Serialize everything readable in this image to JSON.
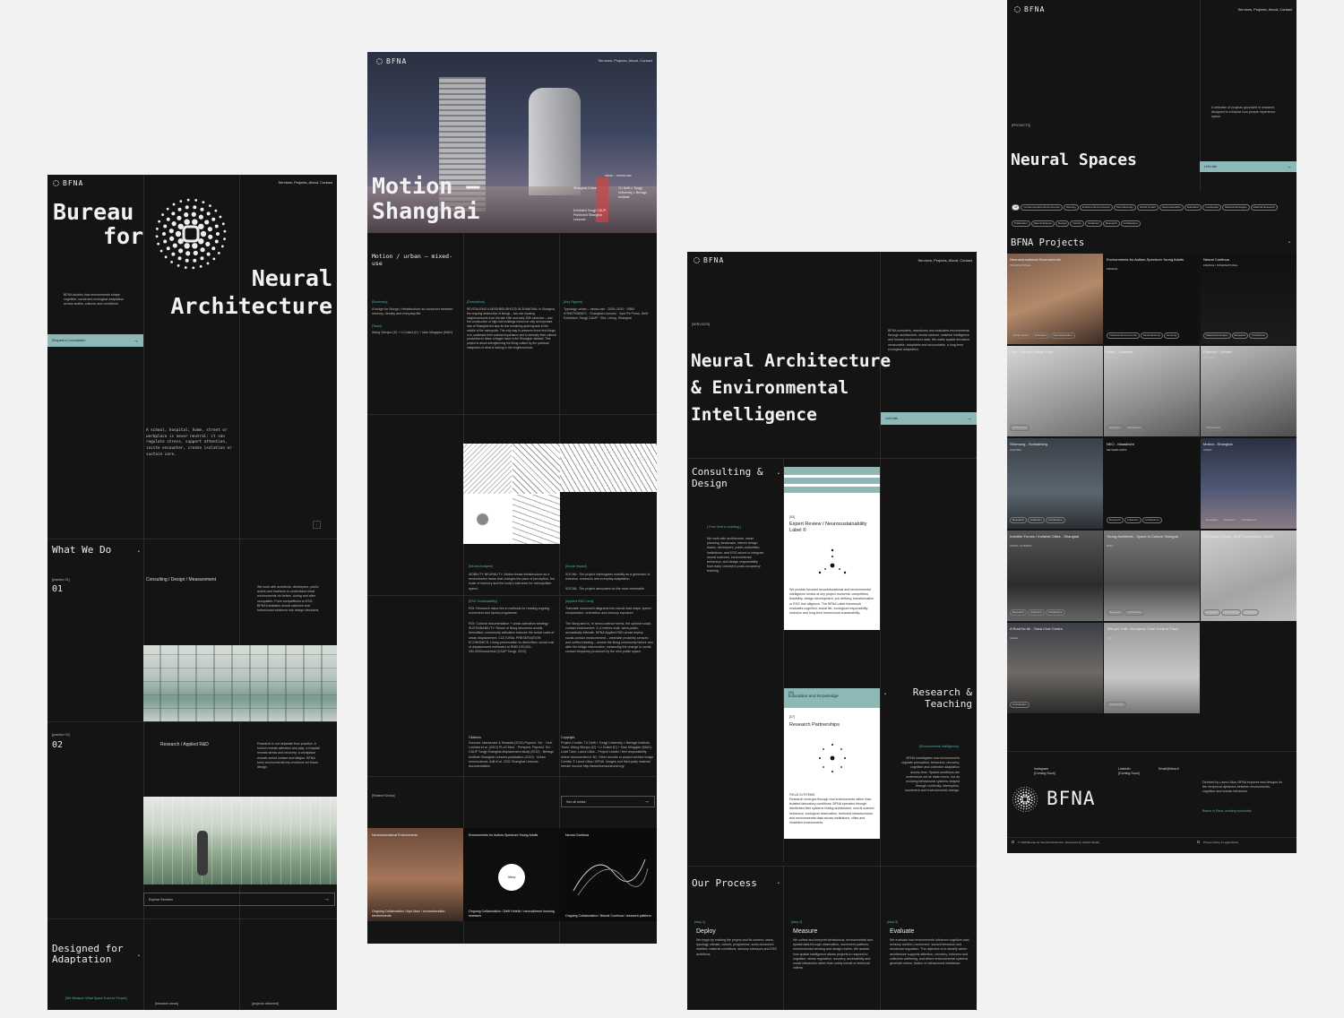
{
  "site": {
    "logo": "BFNA",
    "nav": "Services, Projects, About, Contact"
  },
  "home": {
    "title_lines": [
      "Bureau",
      "for",
      "Neural",
      "Architecture"
    ],
    "intro": "BFNA studies how environments shape cognitive, social and ecological adaptation across scales, cultures and conditions.",
    "cta": "Request a Consultation",
    "statement": "A school, hospital, home, street or workplace is never neutral: it can regulate stress, support attention, invite encounter, create isolation or sustain care.",
    "what_we_do": "What We Do",
    "p1_label": "[practice 01]",
    "p1_num": "01",
    "p1_title": "Consulting / Design / Measurement",
    "p1_text": "We work with architects, developers, public actors and investors to understand what environments do before, during and after occupation. From competitions to ESG, BFNA translates neural sciences and behavioural evidence into design decisions.",
    "p2_label": "[practice 02]",
    "p2_num": "02",
    "p2_title": "Research / Applied R&D",
    "p2_text": "Research is not separate from practice. A school reveals attention and play; a hospital reveals stress and recovery; a workplace reveals social contact and fatigue. BFNA turns environments into evidence for future design.",
    "explore": "Explore Services",
    "adapt_lines": [
      "Designed for",
      "Adaptation"
    ],
    "measure": "[We Measure What Space Does to People]",
    "r1": "[research areas]",
    "r2": "[projects delivered]"
  },
  "project": {
    "title_lines": [
      "Motion –",
      "Shanghai"
    ],
    "hero_meta": [
      "urban – mixed-use",
      "Shanghai China",
      "TU Delft × Tongji University × Berlage Institute",
      "Exhibited Tongji CAUP, Published Shanghai Lessons"
    ],
    "subtitle": "Motion / urban – mixed-use",
    "summary_h": "[Summary]",
    "summary": "A bridge for Mongo / infrastructure as connector between memory, density and everyday life.",
    "team_h": "[Team]",
    "team": "Wang Wenjun (D) + Li Duikui (K) + Mao Mingqian (M&D)",
    "desc_h": "[Description]",
    "desc": "REVITALISING A NEIGHBOURHOOD IN SHANGHAI: In Shanghai, the ongoing destruction of lilongs – low-rise housing neighbourhoods from the late 19th and early 20th centuries – and the construction of high-rise buildings mean not only an important loss of Shanghai but also its few remaining quiet layouts in the middle of the metropolis. The only way to preserve these few lilongs is to undertake their cultural importance and to intensify their cultural production to leave a trigger trace in the Shanghai mindset. This project is about strengthening the lilong culture by the punctual integration of what is lacking in the neighbourhood.",
    "fig_h": "[Key Figures]",
    "fig": "Typology: urban – mixed-use · 2009–2010 · ISBN 9789079369871 · Shanghai Lessons · Xym Pa Press, Delft · Exhibition: Tongji CAUP · Site: Lilong, Shanghai",
    "neural_h": "[Neural Analysis]",
    "neural": "MOBILITY NEURALITY: Motion treats infrastructure as a sensorimotor frame that changes the pace of perception, the scale of memory and the body's tolerance for metropolitan speed.",
    "social_h": "[Social Impact]",
    "social": "SOCIAL: The project interrogates mobility as a generator of inclusion, exclusion and everyday adaptation.",
    "social2": "SOCIAL: The project advocates for the most vulnerable",
    "esg_h": "[ESG Sustainability]",
    "esg": "ROI: Research value lies in methods for reading ongoing movement and hybrid programme.",
    "esg2": "ROI: Cultural documentation + urban activation strategy. SUSTAINABILITY: Reuse of lilong structures avoids demolition; community activation reduces the social costs of urban displacement. CULTURAL PRESERVATION ECONOMICS: Lilong preservation vs demolition: social cost of displacement estimated at RMB 100,000–250,000/household (CAUP Tongji, 2012).",
    "rd_h": "[Applied R&D Lens]",
    "rd": "Translate movement diagrams into neural load maps: speed, compression, orientation and sensory exposure.",
    "rd2": "The lilong lane is, in neuro-science terms, the optimal social-contact environment: 3–5 metres wide, semi-public, acoustically intimate. BFNA Applied R&D would deploy social-contact measurement – wearable proximity sensors and unified tracking – across the lilong community before and after the bridge intervention, measuring the change in social-contact frequency produced by the new public space.",
    "cit_h": "Citations",
    "cit": "Sources: Mackenzie & Mossala (2010) Psychol. Sci. · Holt-Lunstad et al. (2010) PLoS Med. · Perspect. Psychol. Sci. · CAUP Tongji Shanghai displacement study (2012) · Berlage Institute Shanghai Lessons publication (2010) · Urban neuroscience: Adli et al. 2022 Shanghai Lessons documentation.",
    "copy_h": "Copyright",
    "copy": "Project Credits: TU Delft × Tongji University × Berlage Institute. Team: Wang Wenjun (D) + Li Duikui (K) + Mao Mingqian (M&D). Lead Tutor: Laura Ulloa – Project Leader / text responsibility where documented in 3D; Other records or project archive image Credits: © Laura Ulloa / BFNA. Images and third-party material remain /source http://www.bureauneural.org/",
    "related": "[Related Works]",
    "see_all": "See all works",
    "rel": [
      {
        "title": "Neuroeducational Environments",
        "foot": "Ongoing Collaboration / Apo Nour / neuroeducation environments"
      },
      {
        "title": "Environments for Autism-Spectrum Young Adults",
        "badge": "View",
        "foot": "Ongoing Collaboration / Delft Hotelst / neurodiverse housing research"
      },
      {
        "title": "Neural Continua",
        "foot": "Ongoing Collaboration / Neural Continua / research platform"
      }
    ]
  },
  "services": {
    "tag": "[SERVICES]",
    "title_lines": [
      "Neural Architecture",
      "& Environmental",
      "Intelligence"
    ],
    "intro": "BFNA considers, transforms and evaluates environments through architecture, neural science, material intelligence and human environment data. We make spatial decisions measurable, adaptable and accountable, a long-term ecological adaptation.",
    "cta": "Let's talk",
    "consult_lines": [
      "Consulting &",
      "Design"
    ],
    "consult_tag": "[ From brief to building ]",
    "consult": "We work with architecture, urban planning, landscape, interior design teams, developers, public authorities, institutions, and ESG actors to integrate neural sciences, environmental behaviour, and design responsibility from early concept to post-occupancy learning.",
    "card1_num": "[05]",
    "card1_title": "Expert Review / Neurosustainability Label ©",
    "card1_text": "We provide focused neuroeducational and environmental intelligence review at key project moments: competition, feasibility, design development, pre-delivery, transformation or ESG due diligence. The BFNA Label framework evaluates cognition, social life, ecological responsibility, inclusion and long-term behavioural sustainability.",
    "card2_head": "Education and Knowledge",
    "card2_head_num": "[06]",
    "card2_num": "[07]",
    "card2_title": "Research Partnerships",
    "card2_sub": "FIELD SYSTEMS",
    "card2_text": "Research emerges through real environments rather than isolated laboratory conditions. BFNA operates through distributed field systems linking architecture, neural science, behaviour, ecological observation, territorial infrastructures and environmental data across institutions, cities and inhabited environments.",
    "research_lines": [
      "Research &",
      "Teaching"
    ],
    "env_tag": "[Environmental Intelligence]",
    "env": "BFNA investigates how environments regulate perception, behaviour, recovery, cognition and collective adaptation across time. Spatial conditions are understood not as static forms, but as evolving behavioural systems shaped through continuity, interruption, movement and environmental change.",
    "process": "Our Process",
    "steps": [
      {
        "num": "[step-1]",
        "title": "Deploy",
        "text": "We begin by reading the project and its context: users, typology, climate, culture, programme, socio-economic realities, material conditions, sensory stressors and ESG ambitions."
      },
      {
        "num": "[step-2]",
        "title": "Measure",
        "text": "We collect and interpret behavioural, environmental and spatial data through observation, movement patterns, environmental sensing and design review. We assess how spatial intelligence allows projects to respond to cognition, stress regulation, recovery, accessibility and social interaction rather than solely formal or technical criteria."
      },
      {
        "num": "[step-3]",
        "title": "Evaluate",
        "text": "We evaluate how environments influence cognitive load, sensory comfort, movement, social interaction and emotional regulation. The objective is to identify where architecture supports attention, recovery, inclusion and collective wellbeing, and where environmental systems generate stress, friction or behavioural imbalance."
      }
    ]
  },
  "projects": {
    "tag": "[PROJECTS]",
    "title": "Neural Spaces",
    "intro": "A selection of projects grounded in research, designed to enhance how people experience space.",
    "cta": "Let's talk",
    "filters": [
      "All",
      "Contemporative Environments",
      "Housing",
      "Inclusive Environments",
      "Neurodiversity",
      "Social Impact",
      "Neuroeducation",
      "Education",
      "Landscape",
      "Material Ecologies",
      "Material Research",
      "Publication",
      "Neural Science",
      "Design",
      "Culture",
      "Urbanism",
      "Research",
      "Architecture"
    ],
    "list_title": "BFNA Projects",
    "items": [
      {
        "title": "Neuroeducational Environments",
        "country": "INTERNATIONAL",
        "chips": [
          "Social Impact",
          "Education",
          "Neuroeducation"
        ]
      },
      {
        "title": "Environments for Autism-Spectrum Young Adults",
        "country": "FRANCE",
        "chips": [
          "Inclusive Environments",
          "Neurodiversity",
          "Housing"
        ]
      },
      {
        "title": "Neural Continua",
        "country": "FRANCE / INTERNATIONAL",
        "chips": [
          "Material Ecologies",
          "Research",
          "Publication"
        ]
      },
      {
        "title": "Flow - Vienna Culture Zone",
        "country": "AUSTRIA",
        "chips": [
          "Architecture"
        ]
      },
      {
        "title": "Mesh - Carinthia",
        "country": "AUSTRIA",
        "chips": [
          "Urbanism",
          "Architecture"
        ]
      },
      {
        "title": "Diffusion - Vienna",
        "country": "AUSTRIA",
        "chips": [
          "Architecture"
        ]
      },
      {
        "title": "Strömung - Schladming",
        "country": "AUSTRIA",
        "chips": [
          "Research",
          "Urbanism",
          "Architecture"
        ]
      },
      {
        "title": "NEO - Maastricht",
        "country": "NETHERLANDS",
        "chips": [
          "Research",
          "Urbanism",
          "Architecture"
        ]
      },
      {
        "title": "Motion - Shanghai",
        "country": "CHINA",
        "chips": [
          "Research",
          "Urbanism",
          "Architecture"
        ]
      },
      {
        "title": "Invisible Forces / Invisible Cities - Shanghai",
        "country": "CHINA / AUSTRIA",
        "chips": [
          "Research",
          "Urbanism",
          "Architecture"
        ]
      },
      {
        "title": "Young Architects - Space to Culture, Bologna",
        "country": "ITALY",
        "chips": [
          "Research",
          "Architecture"
        ]
      },
      {
        "title": "Noi Siamo Roma - AWP Competition, Rome",
        "country": "ITALY",
        "chips": [
          "Research",
          "Architecture",
          "Urbanism"
        ]
      },
      {
        "title": "A Roof for All - Talca Civic Centre",
        "country": "CHILE",
        "chips": [
          "Architecture"
        ]
      },
      {
        "title": "Tetti per Tutti - European / San Donà di Piave",
        "country": "ITALY",
        "chips": [
          "Architecture"
        ]
      }
    ],
    "footer": {
      "instagram": "Instagram",
      "ig_note": "[Coming Soon]",
      "linkedin": "LinkedIn",
      "li_note": "[Coming Soon]",
      "email": "Email@bfna.fr",
      "about": "Directed by Laura Ulloa, BFNA explores and designs for the reciprocal dynamics between environments, cognition and human behaviour.",
      "location": "Based in Paris, working worldwide.",
      "big_logo": "BFNA",
      "copyright": "© 2026 Bureau for Neural Architecture. Developed by Candor Studio.",
      "policy": "Privacy Policy & Legal Notice"
    }
  },
  "colors": {
    "bg": "#141414",
    "accent": "#8db8b8",
    "teal_text": "#4fb0b0",
    "canvas": "#f2f2f2"
  }
}
